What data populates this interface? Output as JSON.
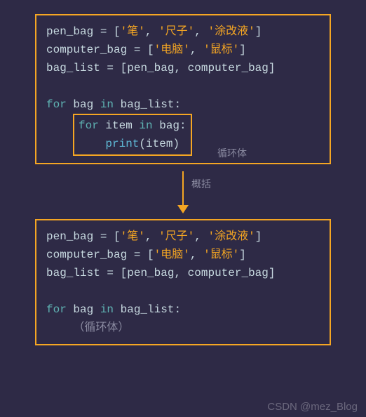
{
  "box1": {
    "l1": {
      "var": "pen_bag",
      "eq": " = ",
      "b1": "[",
      "s1": "'笔'",
      "c1": ", ",
      "s2": "'尺子'",
      "c2": ", ",
      "s3": "'涂改液'",
      "b2": "]"
    },
    "l2": {
      "var": "computer_bag",
      "eq": " = ",
      "b1": "[",
      "s1": "'电脑'",
      "c1": ", ",
      "s2": "'鼠标'",
      "b2": "]"
    },
    "l3": {
      "var": "bag_list",
      "eq": " = ",
      "b1": "[",
      "v1": "pen_bag",
      "c1": ", ",
      "v2": "computer_bag",
      "b2": "]"
    },
    "l4": {
      "kw": "for ",
      "v1": "bag",
      "in": " in ",
      "v2": "bag_list",
      "colon": ":"
    },
    "inner": {
      "l1": {
        "kw": "for ",
        "v1": "item",
        "in": " in ",
        "v2": "bag",
        "colon": ":"
      },
      "l2": {
        "indent": "    ",
        "fn": "print",
        "p1": "(",
        "v": "item",
        "p2": ")"
      }
    },
    "inner_label": "循环体"
  },
  "arrow_label": "概括",
  "box2": {
    "l1": {
      "var": "pen_bag",
      "eq": " = ",
      "b1": "[",
      "s1": "'笔'",
      "c1": ", ",
      "s2": "'尺子'",
      "c2": ", ",
      "s3": "'涂改液'",
      "b2": "]"
    },
    "l2": {
      "var": "computer_bag",
      "eq": " = ",
      "b1": "[",
      "s1": "'电脑'",
      "c1": ", ",
      "s2": "'鼠标'",
      "b2": "]"
    },
    "l3": {
      "var": "bag_list",
      "eq": " = ",
      "b1": "[",
      "v1": "pen_bag",
      "c1": ", ",
      "v2": "computer_bag",
      "b2": "]"
    },
    "l4": {
      "kw": "for ",
      "v1": "bag",
      "in": " in ",
      "v2": "bag_list",
      "colon": ":"
    },
    "l5": {
      "indent": "    ",
      "text": "（循环体）"
    }
  },
  "watermark": "CSDN @mez_Blog"
}
